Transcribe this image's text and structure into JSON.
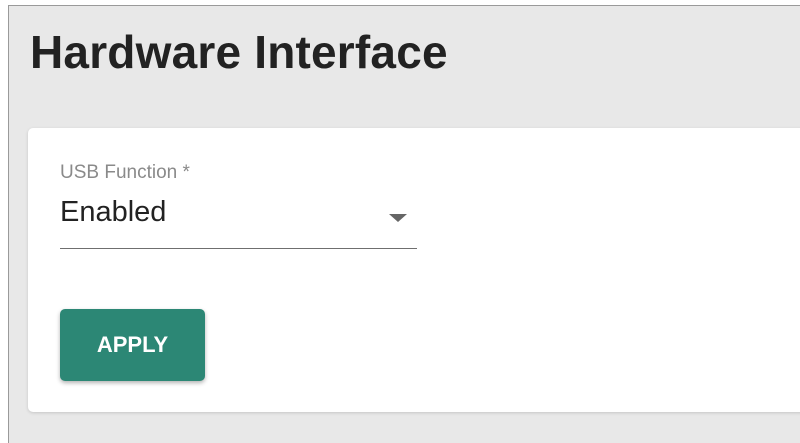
{
  "page": {
    "title": "Hardware Interface"
  },
  "form": {
    "usb_function": {
      "label": "USB Function *",
      "value": "Enabled"
    },
    "apply_label": "APPLY"
  },
  "colors": {
    "background": "#e8e8e8",
    "card": "#ffffff",
    "accent": "#2c8775"
  },
  "icons": {
    "dropdown": "arrow-drop-down-icon"
  }
}
